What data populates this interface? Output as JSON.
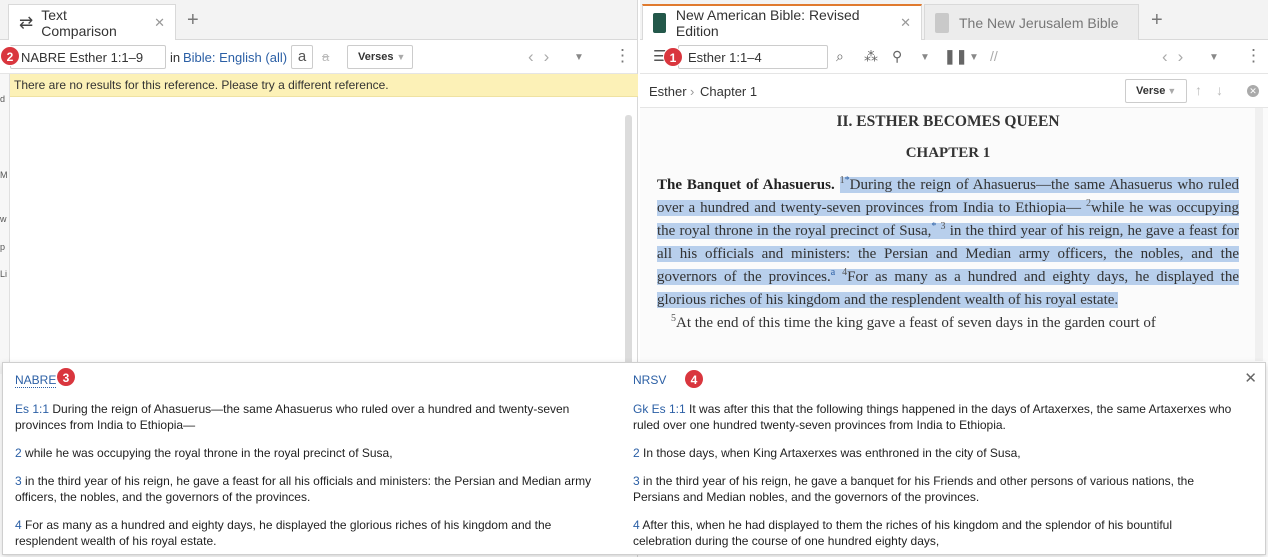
{
  "left": {
    "tab": {
      "label": "Text Comparison"
    },
    "toolbar": {
      "reference": "NABRE Esther 1:1–9",
      "in_label": "in",
      "bible_link": "Bible: English (all)",
      "a_button": "a",
      "strike_a": "a",
      "verses_button": "Verses"
    },
    "notice": "There are no results for this reference. Please try a different reference.",
    "strip_chars": [
      "d",
      "M",
      "w",
      "p",
      "Li"
    ]
  },
  "right": {
    "tabs": [
      {
        "label": "New American Bible: Revised Edition",
        "active": true
      },
      {
        "label": "The New Jerusalem Bible",
        "active": false
      }
    ],
    "toolbar": {
      "reference": "Esther 1:1–4"
    },
    "breadcrumb": [
      "Esther",
      "Chapter 1"
    ],
    "verse_button": "Verse",
    "reader": {
      "section_title": "II. ESTHER BECOMES QUEEN",
      "chapter_title": "CHAPTER 1",
      "pericope": "The Banquet of Ahasuerus.",
      "v1_num": "1",
      "v1_star": "*",
      "v1_text": "During the reign of Ahasuerus—the same Ahasuerus who ruled over a hundred and twenty-seven provinces from India to Ethiopia—",
      "v2_num": "2",
      "v2_text": "while he was occupying the royal throne in the royal precinct of Susa,",
      "v2_star": "*",
      "v3_num": "3",
      "v3_text": "in the third year of his reign, he gave a feast for all his officials and ministers: the Persian and Median army officers, the nobles, and the governors of the provinces.",
      "v3_note": "a",
      "v4_num": "4",
      "v4_text": "For as many as a hundred and eighty days, he displayed the glorious riches of his kingdom and the resplendent wealth of his royal estate.",
      "v5_num": "5",
      "v5_text": "At the end of this time the king gave a feast of seven days in the garden court of"
    }
  },
  "comparison": {
    "left": {
      "header": "NABRE",
      "verses": [
        {
          "ref": "Es 1:1",
          "text": " During the reign of Ahasuerus—the same Ahasuerus who ruled over a hundred and twenty-seven provinces from India to Ethiopia—"
        },
        {
          "ref": "2",
          "text": " while he was occupying the royal throne in the royal precinct of Susa,"
        },
        {
          "ref": "3",
          "text": " in the third year of his reign, he gave a feast for all his officials and ministers: the Persian and Median army officers, the nobles, and the governors of the provinces."
        },
        {
          "ref": "4",
          "text": " For as many as a hundred and eighty days, he displayed the glorious riches of his kingdom and the resplendent wealth of his royal estate."
        }
      ]
    },
    "right": {
      "header": "NRSV",
      "verses": [
        {
          "ref": "Gk Es 1:1",
          "text": " It was after this that the following things happened in the days of Artaxerxes, the same Artaxerxes who ruled over one hundred twenty-seven provinces from India to Ethiopia."
        },
        {
          "ref": "2",
          "text": " In those days, when King Artaxerxes was enthroned in the city of Susa,"
        },
        {
          "ref": "3",
          "text": " in the third year of his reign, he gave a banquet for his Friends and other persons of various nations, the Persians and Median nobles, and the governors of the provinces."
        },
        {
          "ref": "4",
          "text": " After this, when he had displayed to them the riches of his kingdom and the splendor of his bountiful celebration during the course of one hundred eighty days,"
        }
      ]
    }
  },
  "badges": [
    "1",
    "2",
    "3",
    "4"
  ],
  "colors": {
    "link": "#2b5fa5",
    "highlight": "#b8cfec",
    "notice": "#fcf1b7",
    "badge": "#d9363e"
  }
}
